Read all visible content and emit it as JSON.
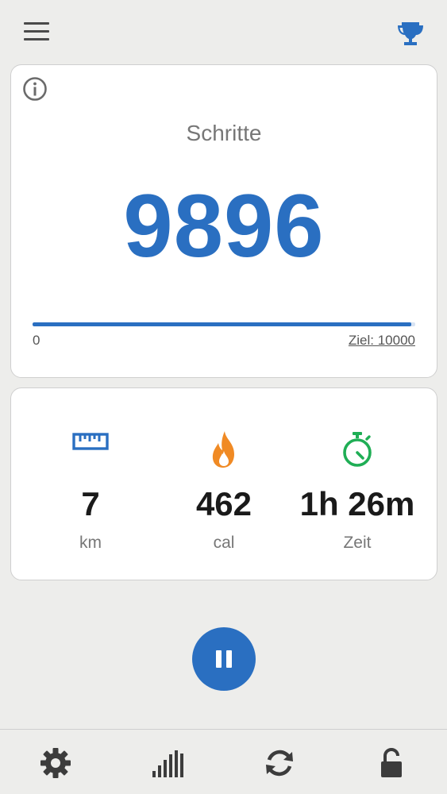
{
  "header": {
    "menu_icon": "hamburger-menu-icon",
    "trophy_icon": "trophy-icon",
    "accent_color": "#2a6fc1"
  },
  "steps_card": {
    "info_icon": "info-icon",
    "label": "Schritte",
    "value": "9896",
    "progress": {
      "min_label": "0",
      "goal_label": "Ziel: 10000",
      "fraction": 0.9896
    }
  },
  "stats": [
    {
      "icon": "ruler-icon",
      "icon_color": "#2a6fc1",
      "value": "7",
      "unit": "km"
    },
    {
      "icon": "flame-icon",
      "icon_color": "#f08a24",
      "value": "462",
      "unit": "cal"
    },
    {
      "icon": "stopwatch-icon",
      "icon_color": "#1fae55",
      "value": "1h 26m",
      "unit": "Zeit"
    }
  ],
  "controls": {
    "pause_icon": "pause-icon"
  },
  "bottom_nav": [
    {
      "icon": "gear-icon"
    },
    {
      "icon": "bar-chart-icon"
    },
    {
      "icon": "refresh-icon"
    },
    {
      "icon": "lock-icon"
    }
  ]
}
